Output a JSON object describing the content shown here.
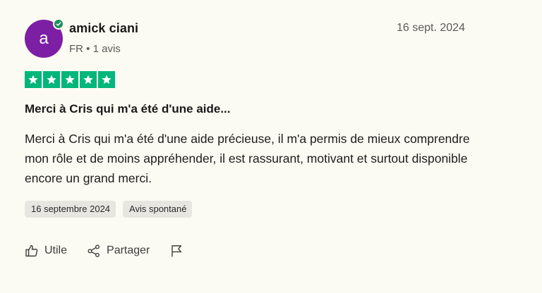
{
  "author": {
    "initial": "a",
    "name": "amick ciani",
    "country": "FR",
    "separator": "•",
    "review_count": "1 avis",
    "avatar_color": "#7d1fa5",
    "verified_color": "#1c8f60"
  },
  "review": {
    "date": "16 sept. 2024",
    "rating": 5,
    "rating_max": 5,
    "star_color": "#00b67a",
    "title": "Merci à Cris qui m'a été d'une aide...",
    "body": "Merci à Cris qui m'a été d'une aide précieuse, il m'a permis de mieux comprendre mon rôle et de moins appréhender, il est rassurant, motivant et surtout disponible encore un grand merci.",
    "experience_date": "16 septembre 2024",
    "source_tag": "Avis spontané"
  },
  "actions": {
    "useful_label": "Utile",
    "useful_icon": "thumbs-up-icon",
    "share_label": "Partager",
    "share_icon": "share-icon",
    "report_icon": "flag-icon"
  }
}
